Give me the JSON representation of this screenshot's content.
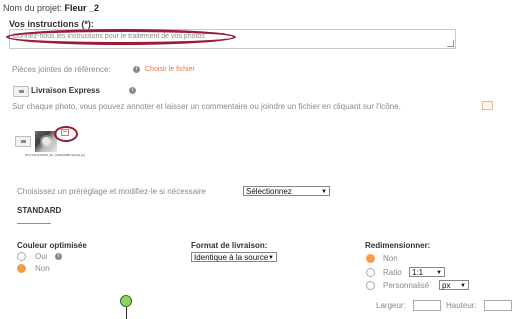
{
  "project": {
    "label": "Nom du projet:",
    "name": "Fleur _2"
  },
  "instructions": {
    "label": "Vos instructions (*):",
    "placeholder": "Donnez-nous les instructions pour le traitement de vos photos"
  },
  "attachments": {
    "label": "Pièces jointes de référence:",
    "link": "Choisir le fichier"
  },
  "express": {
    "label": "Livraison Express"
  },
  "note": "Sur chaque photo, vous pouvez annoter et laisser un commentaire ou joindre un fichier en cliquant sur l'icône.",
  "photo": {
    "filename": "20171011163933_file_5d3f1d8f8b7a6bba.jpg"
  },
  "preset": {
    "label": "Choisissez un préréglage et modifiez-le si nécessaire",
    "select_value": "Sélectionnez",
    "current": "STANDARD"
  },
  "couleur": {
    "label": "Couleur optimisée",
    "options": [
      {
        "label": "Oui",
        "checked": false
      },
      {
        "label": "Non",
        "checked": true
      }
    ]
  },
  "format": {
    "label": "Format de livraison:",
    "value": "Identique à la source"
  },
  "redim": {
    "label": "Redimensionner:",
    "options": [
      {
        "label": "Non",
        "checked": true
      },
      {
        "label": "Ratio",
        "checked": false,
        "select": "1:1"
      },
      {
        "label": "Personnalisé",
        "checked": false,
        "select": "px"
      }
    ],
    "width_label": "Largeur:",
    "height_label": "Hauteur:"
  },
  "colors": {
    "accent": "#e8734a",
    "radio_on": "#f29d4b",
    "annotation": "#9b1c3a",
    "pin": "#8bd65c"
  }
}
